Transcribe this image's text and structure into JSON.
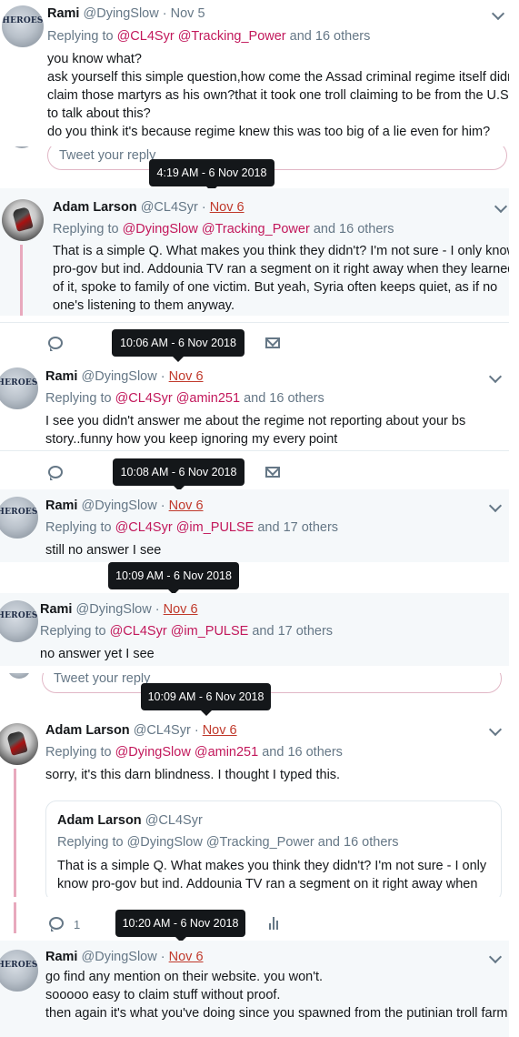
{
  "tweets": [
    {
      "name": "Rami",
      "handle": "@DyingSlow",
      "sep": "·",
      "date": "Nov 5",
      "replying_prefix": "Replying to",
      "mention1": "@CL4Syr",
      "mention2": "@Tracking_Power",
      "replying_suffix": "and 16 others",
      "lines": [
        "you know what?",
        "ask yourself this simple question,how come the Assad criminal regime itself didn't",
        "claim those martyrs as his own?that it took one troll claiming to be from the U.S.",
        "to talk about this?",
        "do you think it's because regime knew this was too big of a lie even for him?"
      ]
    },
    {
      "name": "Adam Larson",
      "handle": "@CL4Syr",
      "sep": "·",
      "date": "Nov 6",
      "replying_prefix": "Replying to",
      "mention1": "@DyingSlow",
      "mention2": "@Tracking_Power",
      "replying_suffix": "and 16 others",
      "lines": [
        "That is a simple Q. What makes you think they didn't? I'm not sure - I only know",
        "pro-gov but ind. Addounia TV ran a segment on it right away when they learned",
        "of it, spoke to family of one victim. But yeah, Syria often keeps quiet, as if no",
        "one's listening to them anyway."
      ]
    },
    {
      "name": "Rami",
      "handle": "@DyingSlow",
      "sep": "·",
      "date": "Nov 6",
      "replying_prefix": "Replying to",
      "mention1": "@CL4Syr",
      "mention2": "@amin251",
      "replying_suffix": "and 16 others",
      "lines": [
        "I see you didn't answer me about the regime not reporting about your bs",
        "story..funny how you keep ignoring my every point"
      ]
    },
    {
      "name": "Rami",
      "handle": "@DyingSlow",
      "sep": "·",
      "date": "Nov 6",
      "replying_prefix": "Replying to",
      "mention1": "@CL4Syr",
      "mention2": "@im_PULSE",
      "replying_suffix": "and 17 others",
      "lines": [
        "still no answer I see"
      ]
    },
    {
      "name": "Rami",
      "handle": "@DyingSlow",
      "sep": "·",
      "date": "Nov 6",
      "replying_prefix": "Replying to",
      "mention1": "@CL4Syr",
      "mention2": "@im_PULSE",
      "replying_suffix": "and 17 others",
      "lines": [
        "no answer yet I see"
      ]
    },
    {
      "name": "Adam Larson",
      "handle": "@CL4Syr",
      "sep": "·",
      "date": "Nov 6",
      "replying_prefix": "Replying to",
      "mention1": "@DyingSlow",
      "mention2": "@amin251",
      "replying_suffix": "and 16 others",
      "lines": [
        "sorry, it's this darn blindness. I thought I typed this."
      ]
    },
    {
      "name": "Rami",
      "handle": "@DyingSlow",
      "sep": "·",
      "date": "Nov 6",
      "lines": [
        "go find any mention on their website. you won't.",
        "sooooo easy to claim stuff without proof.",
        "then again it's what you've doing since you spawned from the putinian troll farm"
      ]
    }
  ],
  "quote": {
    "name": "Adam Larson",
    "handle": "@CL4Syr",
    "replying": "Replying to @DyingSlow @Tracking_Power and 16 others",
    "lines": [
      "That is a simple Q. What makes you think they didn't? I'm not sure - I only",
      "know pro-gov but ind. Addounia TV ran a segment on it right away when"
    ]
  },
  "tooltips": [
    "4:19 AM - 6 Nov 2018",
    "10:06 AM - 6 Nov 2018",
    "10:08 AM - 6 Nov 2018",
    "10:09 AM - 6 Nov 2018",
    "10:09 AM - 6 Nov 2018",
    "10:20 AM - 6 Nov 2018"
  ],
  "reply_placeholder": "Tweet your reply",
  "reply_count": "1",
  "avatar_text": "HEROES",
  "colors": {
    "mention": "#c2185b",
    "thread_line": "#e8a9bd",
    "muted": "#657786"
  }
}
